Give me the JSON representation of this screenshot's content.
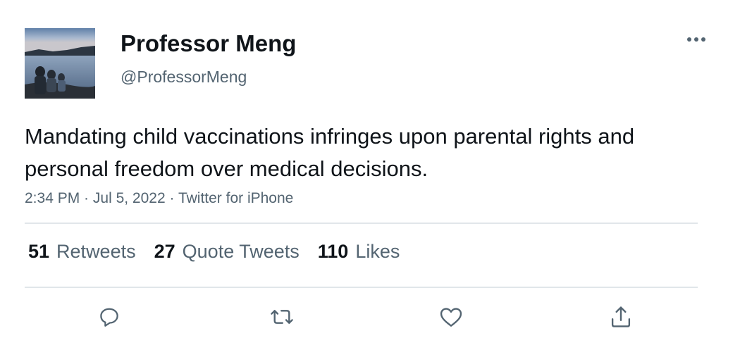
{
  "user": {
    "display_name": "Professor Meng",
    "handle": "@ProfessorMeng",
    "avatar_icon": "avatar-photo-family-by-lake"
  },
  "tweet": {
    "text": "Mandating child vaccinations infringes upon parental rights and personal freedom over medical decisions.",
    "time": "2:34 PM",
    "separator": " · ",
    "date": "Jul 5, 2022",
    "source": "Twitter for iPhone"
  },
  "stats": {
    "retweets_count": "51",
    "retweets_label": "Retweets",
    "quotes_count": "27",
    "quotes_label": "Quote Tweets",
    "likes_count": "110",
    "likes_label": "Likes"
  },
  "actions": [
    "reply-icon",
    "retweet-icon",
    "like-icon",
    "share-icon"
  ],
  "colors": {
    "text": "#0f1419",
    "secondary": "#536471",
    "divider": "#e1e6ea"
  }
}
